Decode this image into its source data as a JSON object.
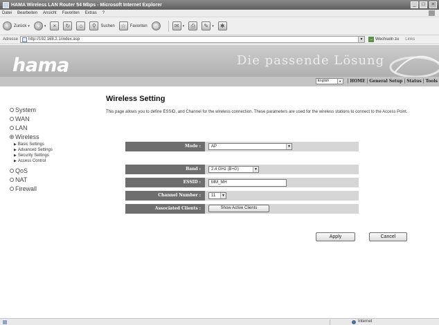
{
  "window": {
    "title": "HAMA Wireless LAN Router 54 Mbps - Microsoft Internet Explorer",
    "controls": {
      "minimize": "_",
      "maximize": "□",
      "close": "×"
    }
  },
  "menu": [
    "Datei",
    "Bearbeiten",
    "Ansicht",
    "Favoriten",
    "Extras",
    "?"
  ],
  "toolbar": {
    "back_label": "Zurück",
    "search_label": "Suchen",
    "favorites_label": "Favoriten",
    "icons": [
      "back-icon",
      "forward-icon",
      "stop-icon",
      "refresh-icon",
      "home-icon",
      "search-icon",
      "star-icon",
      "history-icon",
      "mail-icon",
      "print-icon",
      "edit-icon",
      "messenger-icon"
    ]
  },
  "address": {
    "label": "Adresse",
    "url": "http://192.168.2.1/index.asp",
    "go_label": "Wechseln zu",
    "links_label": "Links"
  },
  "banner": {
    "logo": "hama",
    "slogan": "Die passende Lösung"
  },
  "nav": {
    "language": "English",
    "items": [
      "HOME",
      "General Setup",
      "Status",
      "Tools"
    ]
  },
  "sidebar": {
    "items": [
      {
        "label": "System",
        "selected": false
      },
      {
        "label": "WAN",
        "selected": false
      },
      {
        "label": "LAN",
        "selected": false
      },
      {
        "label": "Wireless",
        "selected": true
      },
      {
        "label": "QoS",
        "selected": false
      },
      {
        "label": "NAT",
        "selected": false
      },
      {
        "label": "Firewall",
        "selected": false
      }
    ],
    "wireless_sub": [
      "Basic Settings",
      "Advanced Settings",
      "Security Settings",
      "Access Control"
    ]
  },
  "main": {
    "heading": "Wireless Setting",
    "description": "This page allows you to define ESSID, and Channel for the wireless connection. These parameters are used for the wireless stations to connect to the Access Point.",
    "mode": {
      "label": "Mode :",
      "value": "AP"
    },
    "band": {
      "label": "Band :",
      "value": "2.4 GHz (B+G)"
    },
    "essid": {
      "label": "ESSID :",
      "value": "MM_MH"
    },
    "channel": {
      "label": "Channel Number :",
      "value": "11"
    },
    "clients": {
      "label": "Associated Clients :",
      "button": "Show Active Clients"
    },
    "apply": "Apply",
    "cancel": "Cancel"
  },
  "status": {
    "zone": "Internet"
  },
  "colors": {
    "label_cell": "#6e6e6e",
    "row_bg": "#d6d6d6",
    "banner": "#b8b8b8"
  }
}
